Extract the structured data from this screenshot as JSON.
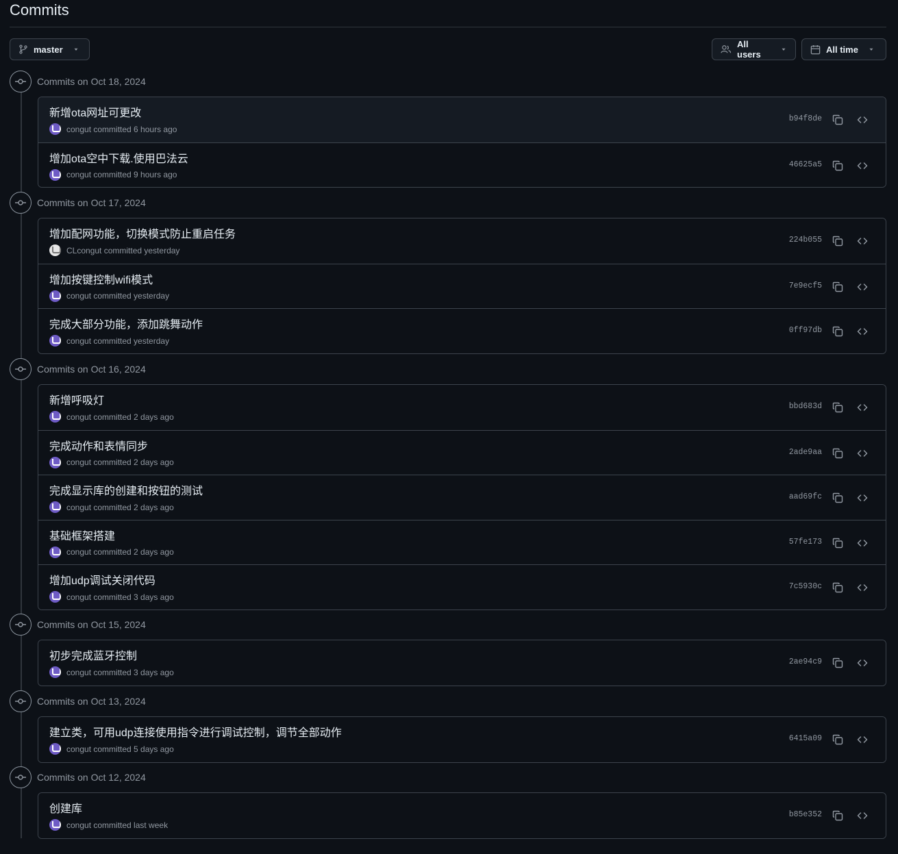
{
  "page": {
    "title": "Commits"
  },
  "toolbar": {
    "branch_label": "master",
    "users_label": "All users",
    "time_label": "All time"
  },
  "groups": [
    {
      "label": "Commits on Oct 18, 2024",
      "commits": [
        {
          "message": "新增ota网址可更改",
          "meta": "congut committed 6 hours ago",
          "sha": "b94f8de"
        },
        {
          "message": "增加ota空中下载.使用巴法云",
          "meta": "congut committed 9 hours ago",
          "sha": "46625a5"
        }
      ]
    },
    {
      "label": "Commits on Oct 17, 2024",
      "commits": [
        {
          "message": "增加配网功能，切换模式防止重启任务",
          "meta": "CLcongut committed yesterday",
          "sha": "224b055"
        },
        {
          "message": "增加按键控制wifi模式",
          "meta": "congut committed yesterday",
          "sha": "7e9ecf5"
        },
        {
          "message": "完成大部分功能，添加跳舞动作",
          "meta": "congut committed yesterday",
          "sha": "0ff97db"
        }
      ]
    },
    {
      "label": "Commits on Oct 16, 2024",
      "commits": [
        {
          "message": "新增呼吸灯",
          "meta": "congut committed 2 days ago",
          "sha": "bbd683d"
        },
        {
          "message": "完成动作和表情同步",
          "meta": "congut committed 2 days ago",
          "sha": "2ade9aa"
        },
        {
          "message": "完成显示库的创建和按钮的测试",
          "meta": "congut committed 2 days ago",
          "sha": "aad69fc"
        },
        {
          "message": "基础框架搭建",
          "meta": "congut committed 2 days ago",
          "sha": "57fe173"
        },
        {
          "message": "增加udp调试关闭代码",
          "meta": "congut committed 3 days ago",
          "sha": "7c5930c"
        }
      ]
    },
    {
      "label": "Commits on Oct 15, 2024",
      "commits": [
        {
          "message": "初步完成蓝牙控制",
          "meta": "congut committed 3 days ago",
          "sha": "2ae94c9"
        }
      ]
    },
    {
      "label": "Commits on Oct 13, 2024",
      "commits": [
        {
          "message": "建立类，可用udp连接使用指令进行调试控制，调节全部动作",
          "meta": "congut committed 5 days ago",
          "sha": "6415a09"
        }
      ]
    },
    {
      "label": "Commits on Oct 12, 2024",
      "commits": [
        {
          "message": "创建库",
          "meta": "congut committed last week",
          "sha": "b85e352"
        }
      ]
    }
  ],
  "icons": {
    "branch": "git-branch-icon",
    "users": "people-icon",
    "time": "calendar-icon",
    "dropdown": "triangle-down-icon",
    "timeline": "git-commit-icon",
    "copy": "copy-icon",
    "browse": "code-icon"
  },
  "colors": {
    "background": "#0d1117",
    "border": "#3d444d",
    "text": "#e6edf3",
    "muted": "#9198a1"
  }
}
